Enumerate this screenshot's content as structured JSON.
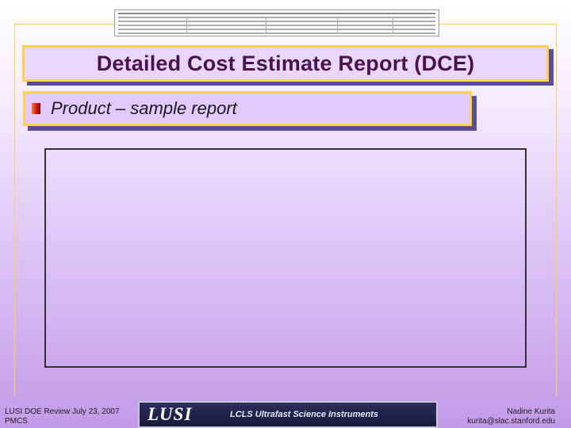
{
  "slide": {
    "title": "Detailed Cost Estimate Report (DCE)",
    "bullet": "Product – sample report"
  },
  "footer": {
    "left_line1": "LUSI DOE Review July 23, 2007",
    "left_line2": "PMCS",
    "logo_mark": "LUSI",
    "logo_tagline": "LCLS Ultrafast Science Instruments",
    "right_line1": "Nadine Kurita",
    "right_line2": "kurita@slac.stanford.edu"
  },
  "colors": {
    "title_text": "#4a1150",
    "box_border": "#ffd24a",
    "shadow": "#5a4d9a",
    "bullet": "#d11a1a"
  }
}
